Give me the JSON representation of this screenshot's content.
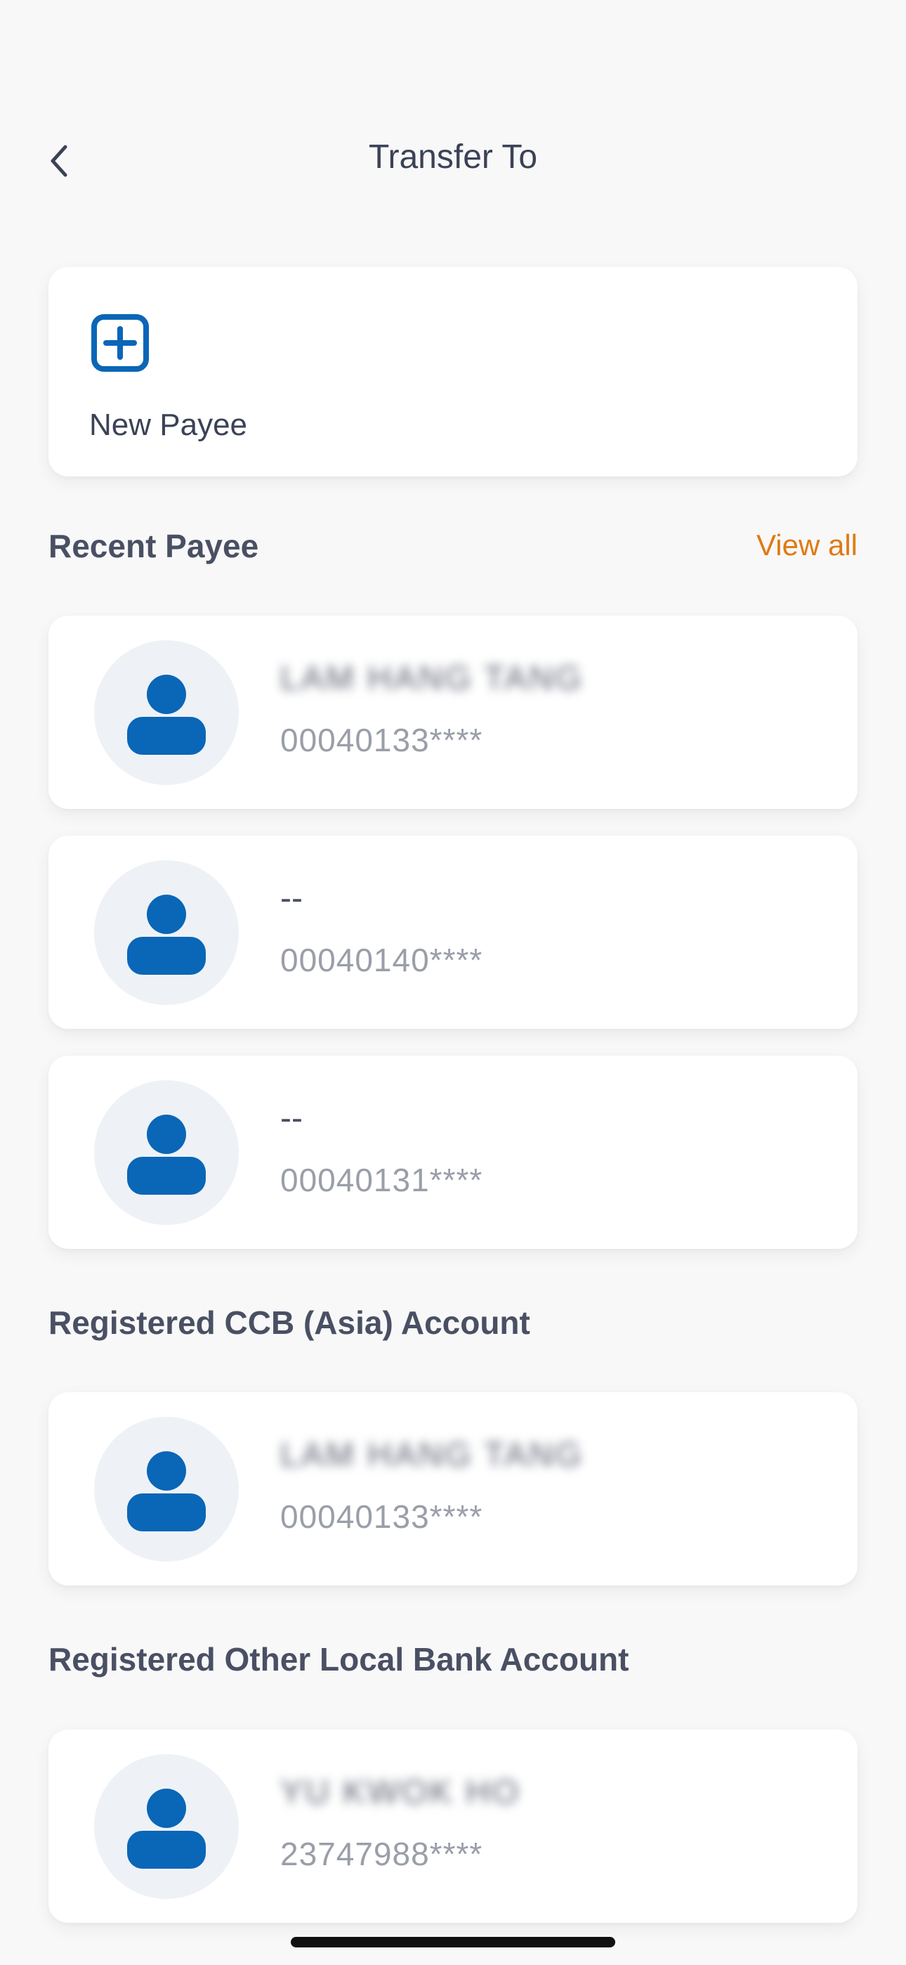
{
  "header": {
    "title": "Transfer To"
  },
  "new_payee": {
    "label": "New Payee",
    "icon": "plus-square-icon"
  },
  "recent": {
    "title": "Recent Payee",
    "view_all": "View all",
    "items": [
      {
        "name": "LAM HANG TANG",
        "account": "00040133****",
        "name_blurred": true
      },
      {
        "name": "--",
        "account": "00040140****",
        "name_blurred": false
      },
      {
        "name": "--",
        "account": "00040131****",
        "name_blurred": false
      }
    ]
  },
  "registered_ccb": {
    "title": "Registered CCB (Asia) Account",
    "items": [
      {
        "name": "LAM HANG TANG",
        "account": "00040133****",
        "name_blurred": true
      }
    ]
  },
  "registered_other": {
    "title": "Registered Other Local Bank Account",
    "items": [
      {
        "name": "YU KWOK HO",
        "account": "23747988****",
        "name_blurred": true
      }
    ]
  },
  "colors": {
    "brand_blue": "#0a66b7",
    "accent_orange": "#e07a10",
    "avatar_bg": "#eef2f6"
  }
}
